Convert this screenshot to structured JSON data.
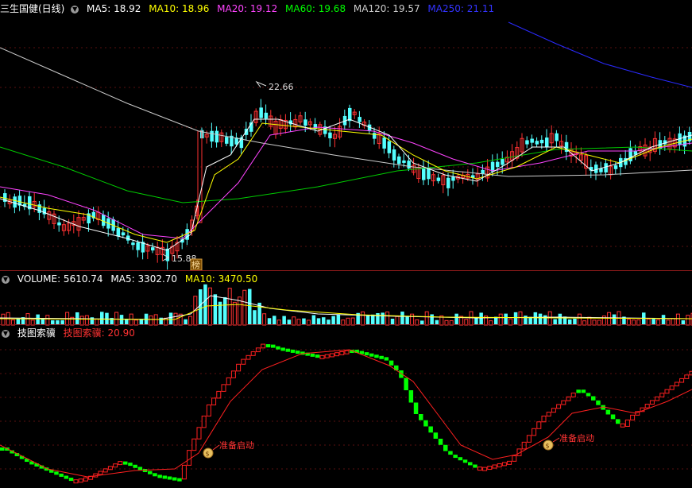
{
  "main_panel": {
    "title": "三生国健(日线)",
    "indicators": [
      {
        "label": "MA5: 18.92",
        "color": "#ffffff"
      },
      {
        "label": "MA10: 18.96",
        "color": "#ffff00"
      },
      {
        "label": "MA20: 19.12",
        "color": "#ff44ff"
      },
      {
        "label": "MA60: 19.68",
        "color": "#00ff00"
      },
      {
        "label": "MA120: 19.57",
        "color": "#cccccc"
      },
      {
        "label": "MA250: 21.11",
        "color": "#3333ff"
      }
    ],
    "high_label": "22.66",
    "low_label": "15.88",
    "badge": "榜"
  },
  "volume_panel": {
    "indicators": [
      {
        "label": "VOLUME: 5610.74",
        "color": "#ffffff"
      },
      {
        "label": "MA5: 3302.70",
        "color": "#ffffff"
      },
      {
        "label": "MA10: 3470.50",
        "color": "#ffff00"
      }
    ]
  },
  "indicator_panel": {
    "name": "技图索骥",
    "value_label": "技图索骥: 20.90",
    "signals": [
      {
        "text": "准备启动"
      },
      {
        "text": "准备启动"
      }
    ]
  },
  "colors": {
    "up": "#ff3232",
    "down": "#54ffff",
    "bull": "#ff2020",
    "bear": "#00ff00",
    "grid": "#8b1a1a"
  }
}
